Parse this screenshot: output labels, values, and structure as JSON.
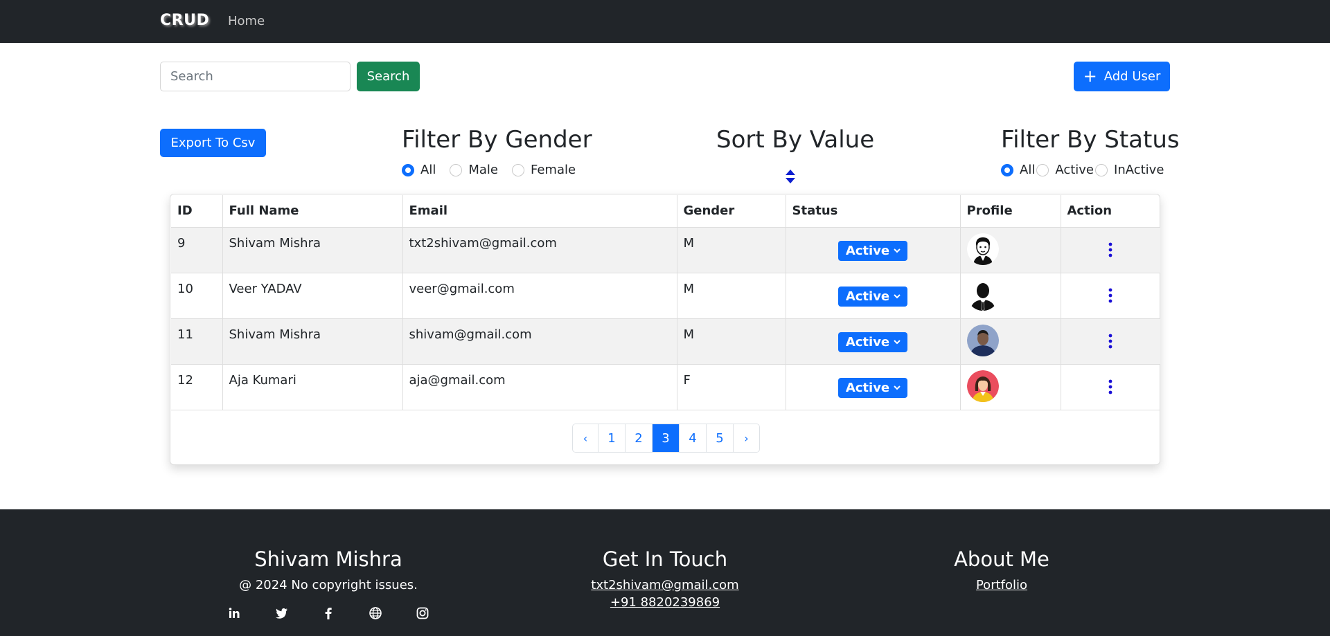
{
  "navbar": {
    "brand": "CRUD",
    "home": "Home"
  },
  "search": {
    "placeholder": "Search",
    "button": "Search"
  },
  "add_user": {
    "label": "Add User",
    "icon": "plus-icon"
  },
  "export": {
    "label": "Export To Csv"
  },
  "filter_gender": {
    "title": "Filter By Gender",
    "options": [
      "All",
      "Male",
      "Female"
    ],
    "selected": "All"
  },
  "sort": {
    "title": "Sort By Value",
    "icon": "sort-icon"
  },
  "filter_status": {
    "title": "Filter By Status",
    "options": [
      "All",
      "Active",
      "InActive"
    ],
    "selected": "All"
  },
  "table": {
    "headers": [
      "ID",
      "Full Name",
      "Email",
      "Gender",
      "Status",
      "Profile",
      "Action"
    ],
    "rows": [
      {
        "id": "9",
        "name": "Shivam Mishra",
        "email": "txt2shivam@gmail.com",
        "gender": "M",
        "status": "Active",
        "avatar": "cartoon-man-avatar"
      },
      {
        "id": "10",
        "name": "Veer YADAV",
        "email": "veer@gmail.com",
        "gender": "M",
        "status": "Active",
        "avatar": "businessman-silhouette-avatar"
      },
      {
        "id": "11",
        "name": "Shivam Mishra",
        "email": "shivam@gmail.com",
        "gender": "M",
        "status": "Active",
        "avatar": "photo-avatar"
      },
      {
        "id": "12",
        "name": "Aja Kumari",
        "email": "aja@gmail.com",
        "gender": "F",
        "status": "Active",
        "avatar": "woman-avatar"
      }
    ]
  },
  "pagination": {
    "prev": "‹",
    "pages": [
      "1",
      "2",
      "3",
      "4",
      "5"
    ],
    "active": "3",
    "next": "›"
  },
  "footer": {
    "col1": {
      "title": "Shivam Mishra",
      "text": "@ 2024 No copyright issues."
    },
    "col2": {
      "title": "Get In Touch",
      "email": "txt2shivam@gmail.com",
      "phone": "+91 8820239869"
    },
    "col3": {
      "title": "About Me",
      "link": "Portfolio"
    },
    "socials": [
      "linkedin-icon",
      "twitter-icon",
      "facebook-icon",
      "globe-icon",
      "instagram-icon"
    ]
  },
  "colors": {
    "navbar": "#212529",
    "primary": "#0d6efd",
    "success": "#198754",
    "footer": "#212529"
  }
}
